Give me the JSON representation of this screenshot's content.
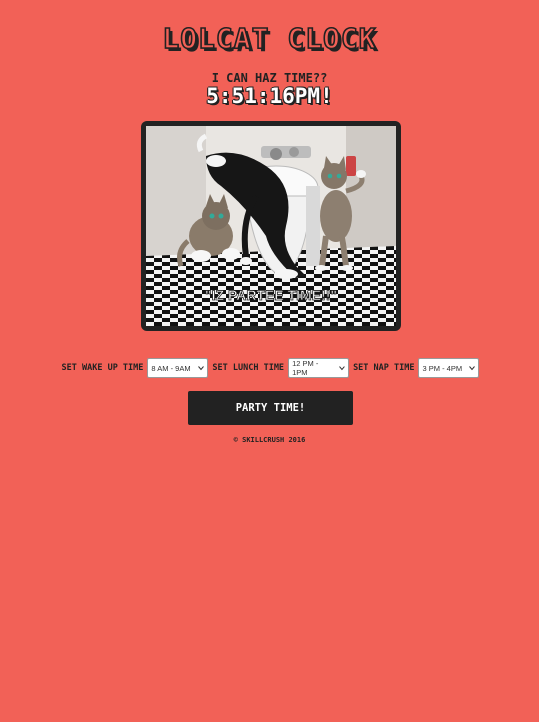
{
  "header": {
    "title": "LOLCAT CLOCK",
    "subtitle": "I CAN HAZ TIME??",
    "clock_time": "5:51:16PM!"
  },
  "photo": {
    "caption": "\"IZ PARTEE TIME!!\"",
    "icon": "party-cats-photo"
  },
  "controls": {
    "wake_label": "SET WAKE UP TIME",
    "wake_value": "8 AM - 9AM",
    "lunch_label": "SET LUNCH TIME",
    "lunch_value": "12 PM - 1PM",
    "nap_label": "SET NAP TIME",
    "nap_value": "3 PM - 4PM"
  },
  "actions": {
    "party_label": "PARTY TIME!"
  },
  "footer": {
    "copyright": "© SKILLCRUSH 2016"
  },
  "colors": {
    "background": "#f26157",
    "dark": "#222222",
    "text_light": "#ffffff"
  }
}
